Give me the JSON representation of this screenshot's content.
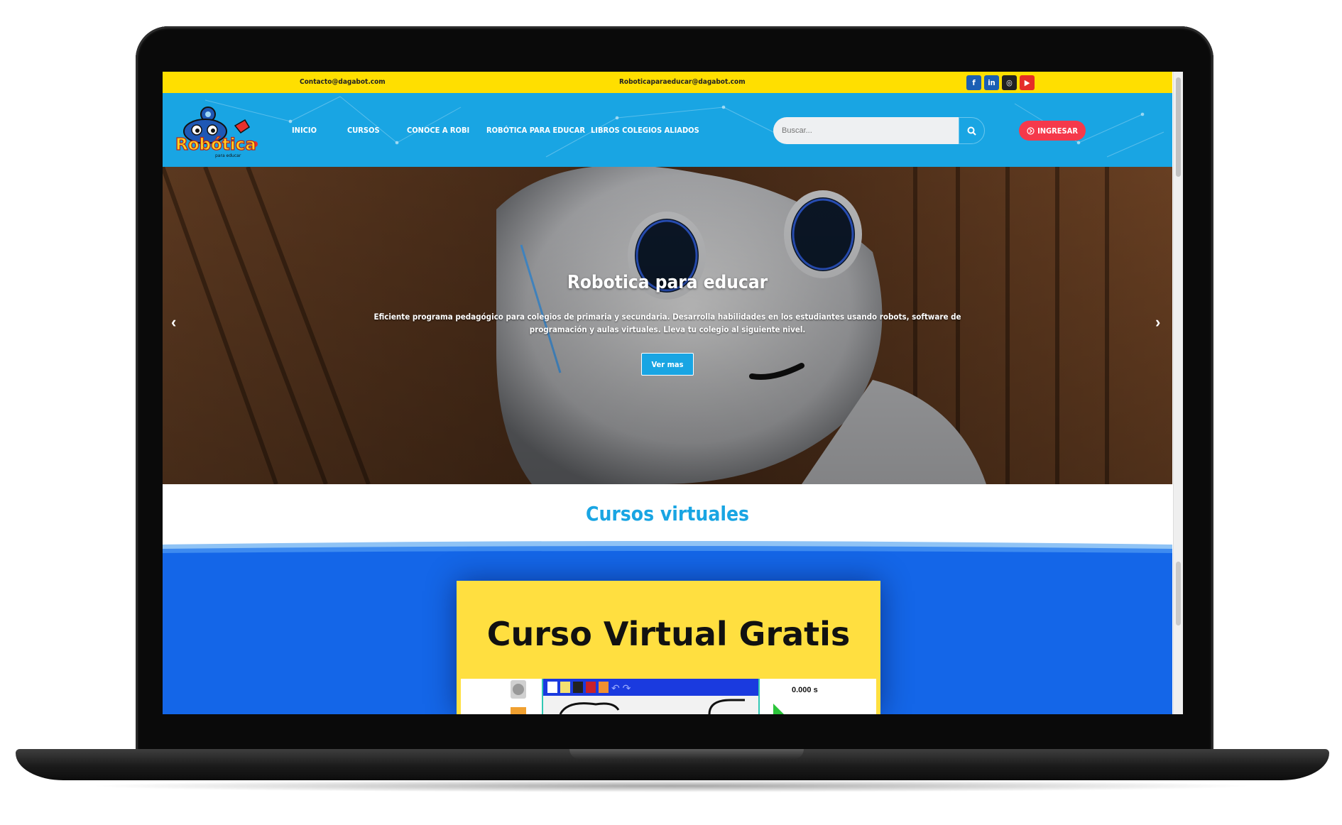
{
  "topbar": {
    "contact_left": "Contacto@dagabot.com",
    "contact_center": "Roboticaparaeducar@dagabot.com",
    "socials": [
      {
        "icon": "facebook-icon",
        "glyph": "f",
        "color": "#1b5fb4"
      },
      {
        "icon": "linkedin-icon",
        "glyph": "in",
        "color": "#1b5fb4"
      },
      {
        "icon": "instagram-icon",
        "glyph": "◎",
        "color": "#222222"
      },
      {
        "icon": "youtube-icon",
        "glyph": "▶",
        "color": "#e52d27"
      }
    ]
  },
  "nav": {
    "logo_text": "Robótica",
    "logo_sub": "para educar",
    "items": [
      "INICIO",
      "CURSOS",
      "CONOCE A ROBI",
      "ROBÓTICA PARA EDUCAR",
      "LIBROS COLEGIOS ALIADOS"
    ],
    "search_placeholder": "Buscar...",
    "login_label": "INGRESAR",
    "accent": "#19a5e3"
  },
  "hero": {
    "title": "Robotica para educar",
    "text": "Eficiente programa pedagógico para colegios de primaria y secundaria. Desarrolla habilidades en los estudiantes usando robots, software de programación y aulas virtuales. Lleva tu colegio al siguiente nivel.",
    "button": "Ver mas",
    "prev_icon": "‹",
    "next_icon": "›"
  },
  "courses": {
    "heading": "Cursos virtuales",
    "card_title": "Curso Virtual Gratis",
    "timer": "0.000 s"
  },
  "colors": {
    "yellow": "#ffdf00",
    "blue_dark": "#1466e8",
    "red": "#f5394b"
  }
}
